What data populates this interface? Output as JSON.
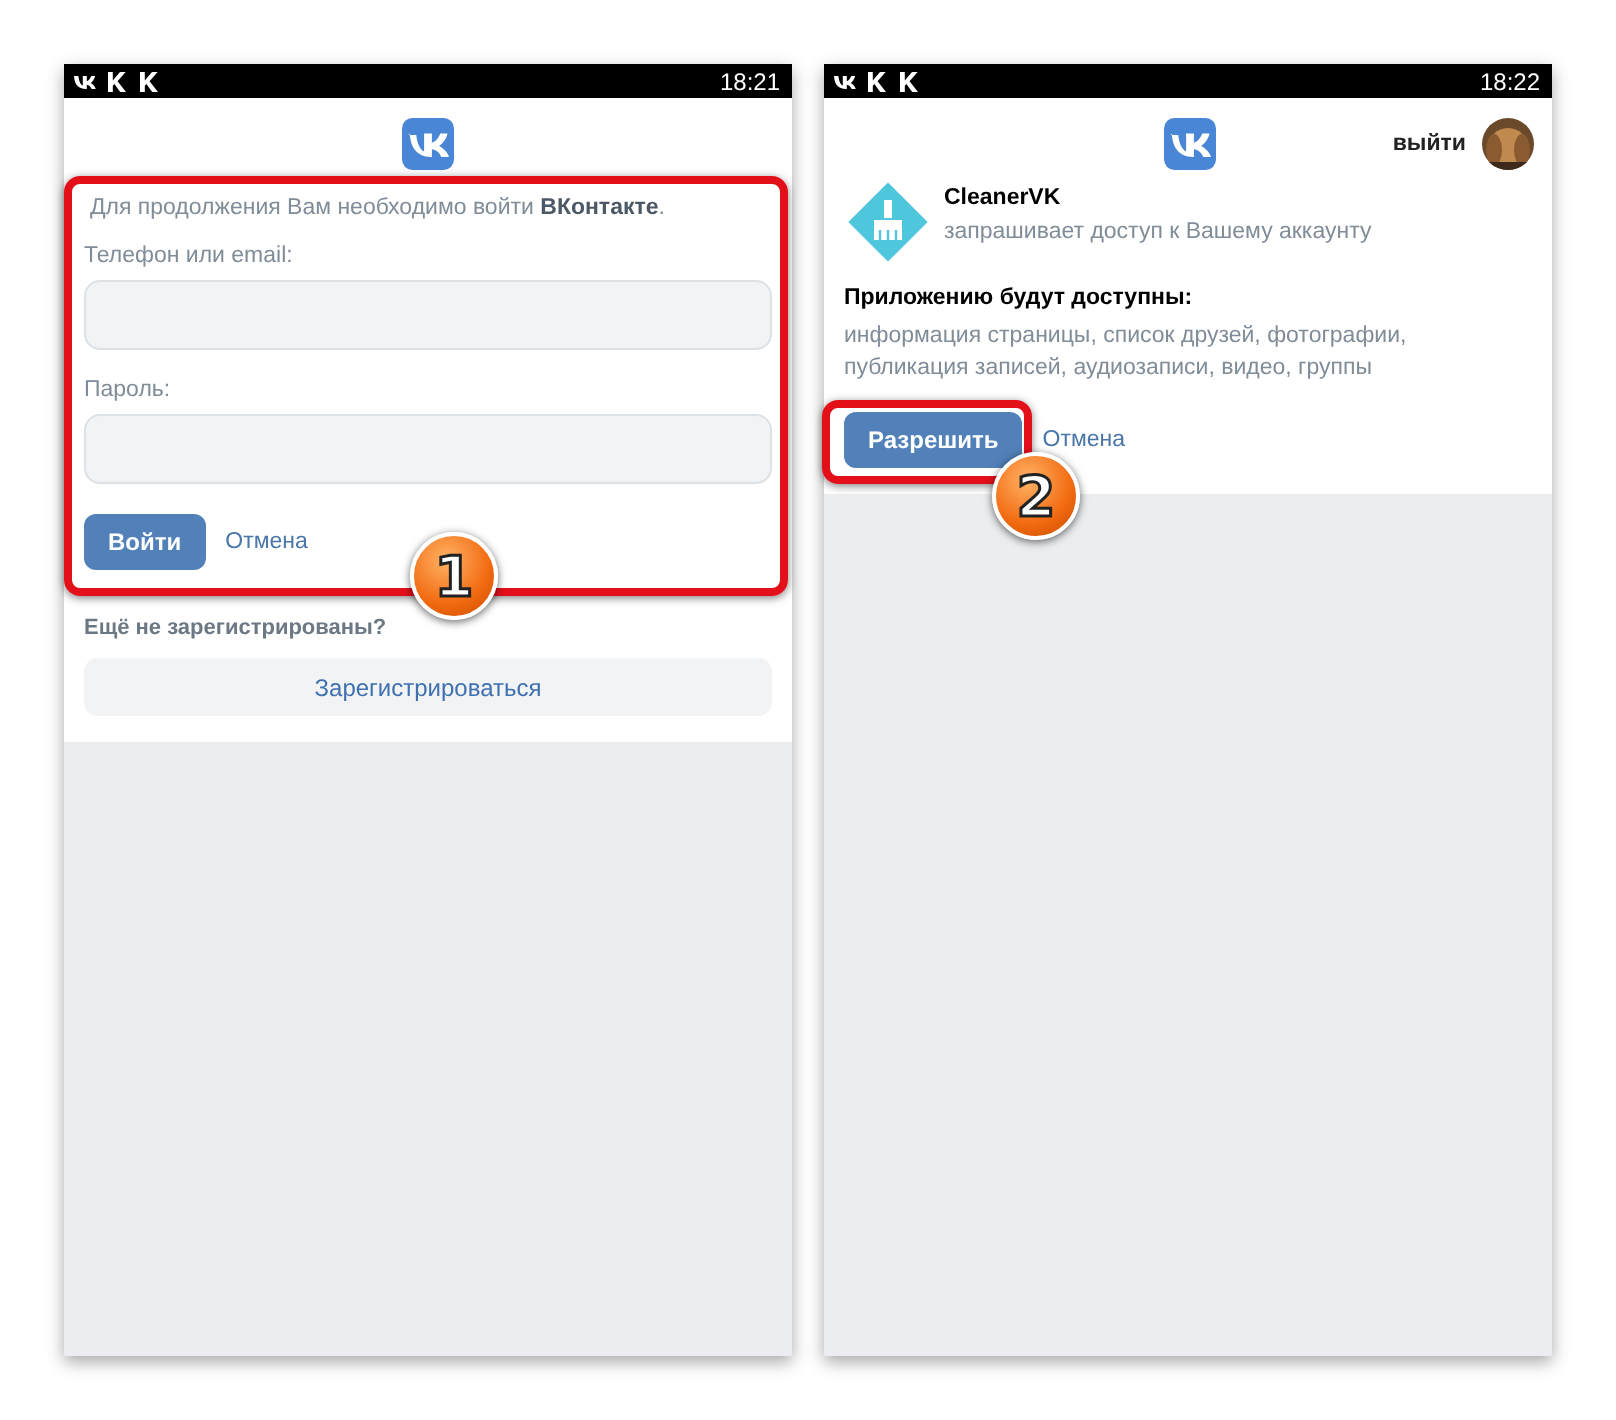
{
  "screens": [
    {
      "kind": "login",
      "status_bar": {
        "time": "18:21"
      },
      "intro": "Для продолжения Вам необходимо войти **ВКонтакте**.",
      "fields": [
        {
          "label": "Телефон или email:"
        },
        {
          "label": "Пароль:"
        }
      ],
      "submit": "Войти",
      "cancel": "Отмена",
      "register_prompt": "Ещё не зарегистрированы?",
      "register_button": "Зарегистрироваться",
      "callout": {
        "number": "1"
      }
    },
    {
      "kind": "permission",
      "status_bar": {
        "time": "18:22"
      },
      "logout": "выйти",
      "app_name": "CleanerVK",
      "app_subtitle": "запрашивает доступ к Вашему аккаунту",
      "access_title": "Приложению будут доступны:",
      "access_list": "информация страницы, список друзей, фотографии, публикация записей, аудиозаписи, видео, группы",
      "submit": "Разрешить",
      "cancel": "Отмена",
      "callout": {
        "number": "2"
      }
    }
  ]
}
